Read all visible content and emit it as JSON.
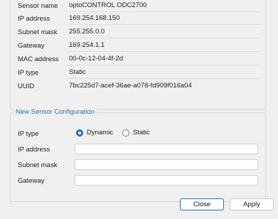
{
  "current": {
    "rows": [
      {
        "label": "Sensor name",
        "value": "optoCONTROL ODC2700"
      },
      {
        "label": "IP address",
        "value": "169.254.168.150"
      },
      {
        "label": "Subnet mask",
        "value": "255.255.0.0"
      },
      {
        "label": "Gateway",
        "value": "169.254.1.1"
      },
      {
        "label": "MAC address",
        "value": "00-0c-12-04-4f-2d"
      },
      {
        "label": "IP type",
        "value": "Static"
      },
      {
        "label": "UUID",
        "value": "7bc225d7-acef-36ae-a078-fd909f016a04"
      }
    ]
  },
  "new_config": {
    "title": "New Sensor Configuration",
    "ip_type_label": "IP type",
    "ip_type_options": [
      "Dynamic",
      "Static"
    ],
    "ip_type_selected": "Dynamic",
    "ip_address_label": "IP address",
    "ip_address_value": "",
    "subnet_mask_label": "Subnet mask",
    "subnet_mask_value": "",
    "gateway_label": "Gateway",
    "gateway_value": ""
  },
  "buttons": {
    "close": "Close",
    "apply": "Apply"
  },
  "colors": {
    "accent": "#2c6fb8",
    "radio_selected": "#1a6fd0"
  }
}
